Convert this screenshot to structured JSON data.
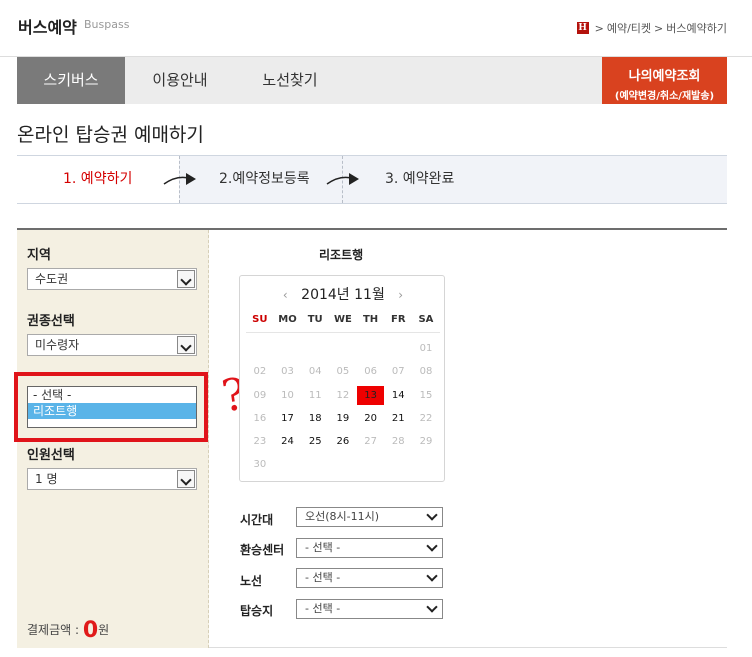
{
  "header": {
    "title": "버스예약",
    "subtitle": "Buspass",
    "home_icon_text": "H",
    "breadcrumb": [
      "예약/티켓",
      "버스예약하기"
    ],
    "breadcrumb_sep": ">"
  },
  "tabs": [
    {
      "label": "스키버스",
      "active": true
    },
    {
      "label": "이용안내",
      "active": false
    },
    {
      "label": "노선찾기",
      "active": false
    }
  ],
  "my_booking": {
    "line1": "나의예약조회",
    "line2": "(예약변경/취소/재발송)",
    "color": "#d9421f"
  },
  "page_title": "온라인 탑승권 예매하기",
  "steps": [
    "1. 예약하기",
    "2.예약정보등록",
    "3. 예약완료"
  ],
  "left_panel": {
    "region": {
      "label": "지역",
      "value": "수도권"
    },
    "ticket_type": {
      "label": "권종선택",
      "value": "미수령자"
    },
    "direction_options": [
      "- 선택 -",
      "리조트행"
    ],
    "direction_selected": "리조트행",
    "people": {
      "label": "인원선택",
      "value": "1 명"
    },
    "payment": {
      "label": "결제금액 :",
      "amount": "0",
      "unit": "원"
    }
  },
  "annotation": {
    "question_mark": "?",
    "color": "#e0141a"
  },
  "destination": "리조트행",
  "calendar": {
    "title": "2014년 11월",
    "prev": "‹",
    "next": "›",
    "weekdays": [
      "SU",
      "MO",
      "TU",
      "WE",
      "TH",
      "FR",
      "SA"
    ],
    "weeks": [
      [
        "",
        "",
        "",
        "",
        "",
        "",
        "01"
      ],
      [
        "02",
        "03",
        "04",
        "05",
        "06",
        "07",
        "08"
      ],
      [
        "09",
        "10",
        "11",
        "12",
        "13",
        "14",
        "15"
      ],
      [
        "16",
        "17",
        "18",
        "19",
        "20",
        "21",
        "22"
      ],
      [
        "23",
        "24",
        "25",
        "26",
        "27",
        "28",
        "29"
      ],
      [
        "30",
        "",
        "",
        "",
        "",
        "",
        ""
      ]
    ],
    "today": "13",
    "available": [
      "14",
      "17",
      "18",
      "19",
      "20",
      "21",
      "24",
      "25",
      "26"
    ]
  },
  "form": [
    {
      "label": "시간대",
      "value": "오선(8시-11시)"
    },
    {
      "label": "환승센터",
      "value": "- 선택 -"
    },
    {
      "label": "노선",
      "value": "- 선택 -"
    },
    {
      "label": "탑승지",
      "value": "- 선택 -"
    }
  ]
}
